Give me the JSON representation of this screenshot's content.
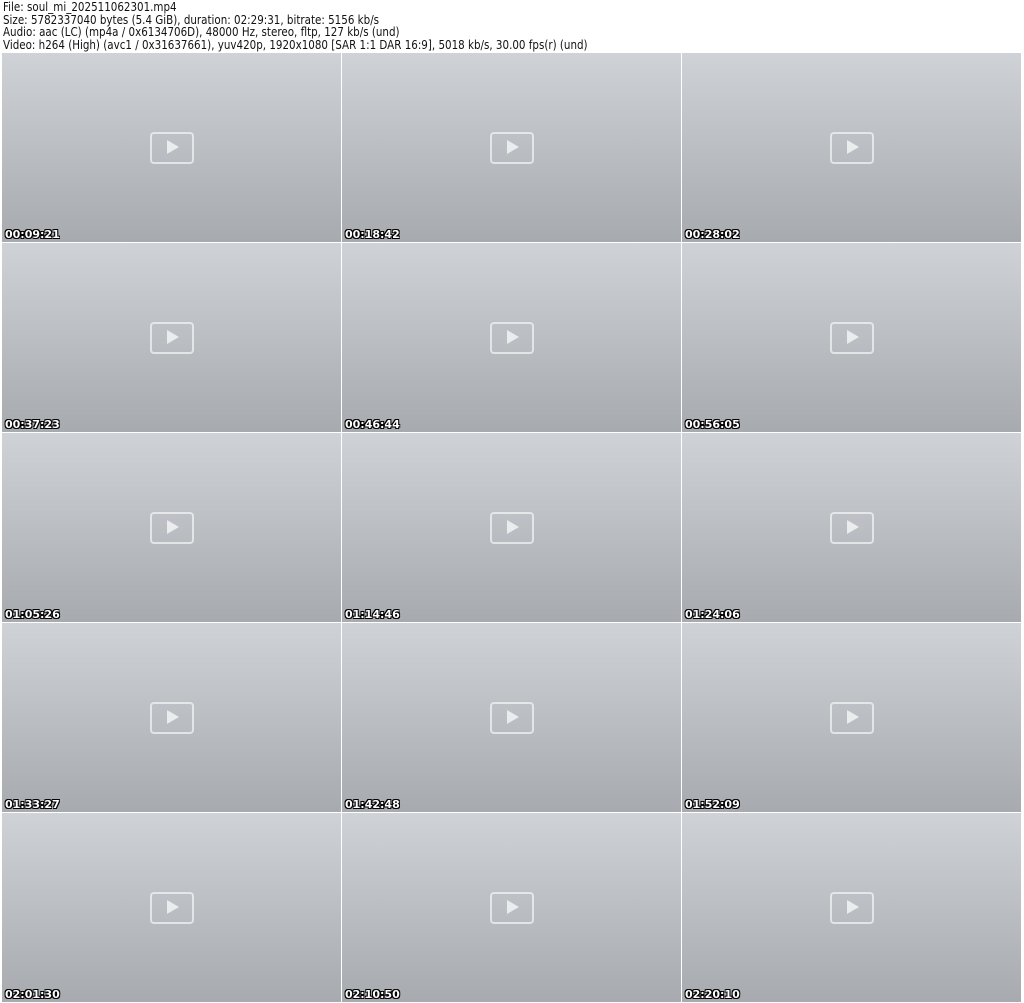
{
  "header": {
    "file": "File: soul_mi_202511062301.mp4",
    "size": "Size: 5782337040 bytes (5.4 GiB), duration: 02:29:31, bitrate: 5156 kb/s",
    "audio": "Audio: aac (LC) (mp4a / 0x6134706D), 48000 Hz, stereo, fltp, 127 kb/s (und)",
    "video": "Video: h264 (High) (avc1 / 0x31637661), yuv420p, 1920x1080 [SAR 1:1 DAR 16:9], 5018 kb/s, 30.00 fps(r) (und)"
  },
  "thumbnails": [
    {
      "timestamp": "00:09:21"
    },
    {
      "timestamp": "00:18:42"
    },
    {
      "timestamp": "00:28:02"
    },
    {
      "timestamp": "00:37:23"
    },
    {
      "timestamp": "00:46:44"
    },
    {
      "timestamp": "00:56:05"
    },
    {
      "timestamp": "01:05:26"
    },
    {
      "timestamp": "01:14:46"
    },
    {
      "timestamp": "01:24:06"
    },
    {
      "timestamp": "01:33:27"
    },
    {
      "timestamp": "01:42:48"
    },
    {
      "timestamp": "01:52:09"
    },
    {
      "timestamp": "02:01:30"
    },
    {
      "timestamp": "02:10:50"
    },
    {
      "timestamp": "02:20:10"
    }
  ]
}
